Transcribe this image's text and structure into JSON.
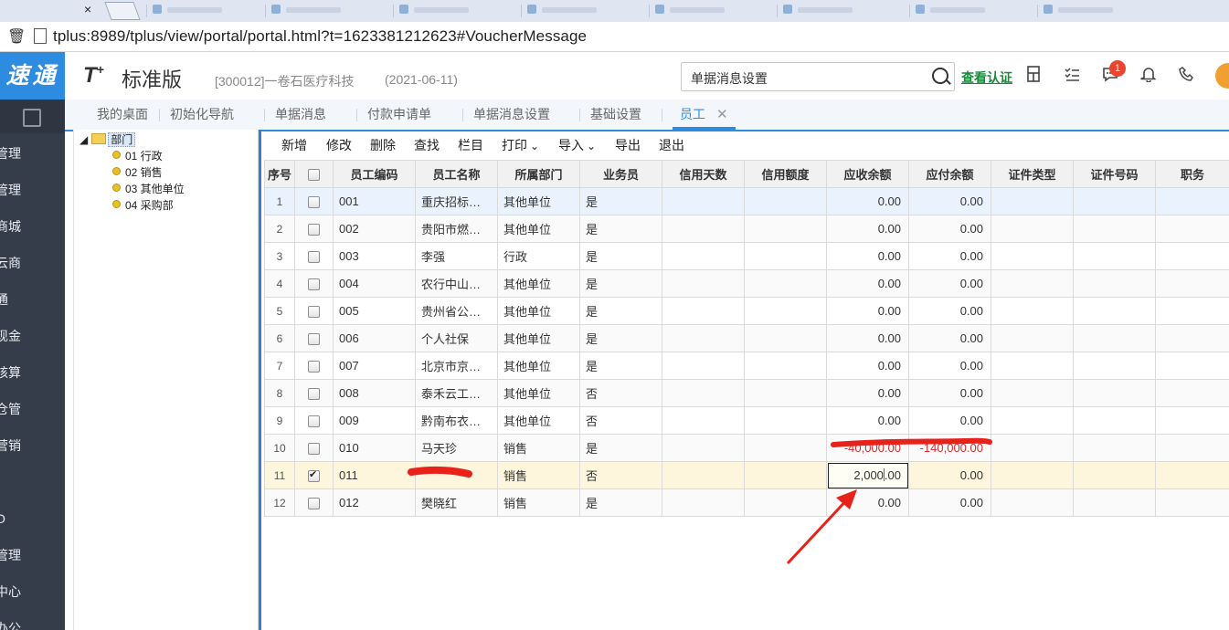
{
  "browser": {
    "tab_close": "×",
    "url_host": "tplus",
    "url_rest": ":8989/tplus/view/portal/portal.html?t=1623381212623#VoucherMessage"
  },
  "header": {
    "brand": "速通",
    "logo_t": "T",
    "logo_plus": "+",
    "product": "标准版",
    "company": "[300012]一卷石医疗科技",
    "period": "(2021-06-11)",
    "search_value": "单据消息设置",
    "verify_link": "查看认证",
    "notify_count": "1"
  },
  "sidebar": {
    "items": [
      "管理",
      "管理",
      "商城",
      "云商",
      "通",
      "现金",
      "核算",
      "仓管",
      "营销",
      "",
      "O",
      "管理",
      "中心",
      "办公"
    ]
  },
  "tabs": [
    "我的桌面",
    "初始化导航",
    "单据消息",
    "付款申请单",
    "单据消息设置",
    "基础设置",
    "员工"
  ],
  "tree": {
    "root": "部门",
    "nodes": [
      "01 行政",
      "02 销售",
      "03 其他单位",
      "04 采购部"
    ]
  },
  "toolbar": [
    "新增",
    "修改",
    "删除",
    "查找",
    "栏目",
    "打印",
    "导入",
    "导出",
    "退出"
  ],
  "toolbar_dropdown_marker": "⌄",
  "grid": {
    "columns": [
      "序号",
      "",
      "员工编码",
      "员工名称",
      "所属部门",
      "业务员",
      "信用天数",
      "信用额度",
      "应收余额",
      "应付余额",
      "证件类型",
      "证件号码",
      "职务"
    ],
    "rows": [
      {
        "no": "1",
        "checked": false,
        "code": "001",
        "name": "重庆招标…",
        "dept": "其他单位",
        "sales": "是",
        "days": "",
        "limit": "",
        "recv": "0.00",
        "pay": "0.00"
      },
      {
        "no": "2",
        "checked": false,
        "code": "002",
        "name": "贵阳市燃…",
        "dept": "其他单位",
        "sales": "是",
        "days": "",
        "limit": "",
        "recv": "0.00",
        "pay": "0.00"
      },
      {
        "no": "3",
        "checked": false,
        "code": "003",
        "name": "李强",
        "dept": "行政",
        "sales": "是",
        "days": "",
        "limit": "",
        "recv": "0.00",
        "pay": "0.00"
      },
      {
        "no": "4",
        "checked": false,
        "code": "004",
        "name": "农行中山…",
        "dept": "其他单位",
        "sales": "是",
        "days": "",
        "limit": "",
        "recv": "0.00",
        "pay": "0.00"
      },
      {
        "no": "5",
        "checked": false,
        "code": "005",
        "name": "贵州省公…",
        "dept": "其他单位",
        "sales": "是",
        "days": "",
        "limit": "",
        "recv": "0.00",
        "pay": "0.00"
      },
      {
        "no": "6",
        "checked": false,
        "code": "006",
        "name": "个人社保",
        "dept": "其他单位",
        "sales": "是",
        "days": "",
        "limit": "",
        "recv": "0.00",
        "pay": "0.00"
      },
      {
        "no": "7",
        "checked": false,
        "code": "007",
        "name": "北京市京…",
        "dept": "其他单位",
        "sales": "是",
        "days": "",
        "limit": "",
        "recv": "0.00",
        "pay": "0.00"
      },
      {
        "no": "8",
        "checked": false,
        "code": "008",
        "name": "泰禾云工…",
        "dept": "其他单位",
        "sales": "否",
        "days": "",
        "limit": "",
        "recv": "0.00",
        "pay": "0.00"
      },
      {
        "no": "9",
        "checked": false,
        "code": "009",
        "name": "黔南布衣…",
        "dept": "其他单位",
        "sales": "否",
        "days": "",
        "limit": "",
        "recv": "0.00",
        "pay": "0.00"
      },
      {
        "no": "10",
        "checked": false,
        "code": "010",
        "name": "马天珍",
        "dept": "销售",
        "sales": "是",
        "days": "",
        "limit": "",
        "recv": "-40,000.00",
        "pay": "-140,000.00"
      },
      {
        "no": "11",
        "checked": true,
        "code": "011",
        "name": "",
        "dept": "销售",
        "sales": "否",
        "days": "",
        "limit": "",
        "recv_before": "2,000",
        "recv_after": ".00",
        "pay": "0.00"
      },
      {
        "no": "12",
        "checked": false,
        "code": "012",
        "name": "樊晓红",
        "dept": "销售",
        "sales": "是",
        "days": "",
        "limit": "",
        "recv": "0.00",
        "pay": "0.00"
      }
    ]
  },
  "colors": {
    "brand_blue": "#2e8ce0",
    "sidebar_bg": "#353d4a",
    "annotation_red": "#e8221b",
    "negative_red": "#d43030",
    "highlight_row": "#fdf6dc"
  }
}
